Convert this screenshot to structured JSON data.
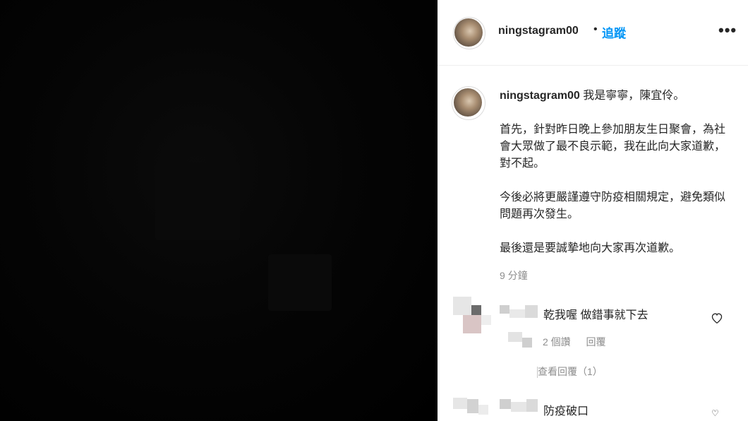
{
  "post": {
    "username": "ningstagram00",
    "separator": "•",
    "follow_label": "追蹤",
    "more_icon": "more-horizontal-icon",
    "more_label": "•••"
  },
  "caption": {
    "username": "ningstagram00",
    "first_line": "我是寧寧，陳宜伶。",
    "paragraphs": [
      "首先，針對昨日晚上參加朋友生日聚會，為社會大眾做了最不良示範，我在此向大家道歉，對不起。",
      "今後必將更嚴謹遵守防疫相關規定，避免類似問題再次發生。",
      "最後還是要誠摯地向大家再次道歉。"
    ],
    "time": "9 分鐘"
  },
  "comments": [
    {
      "text": "乾我喔 做錯事就下去",
      "likes": "2 個讚",
      "reply_label": "回覆",
      "view_replies": "查看回覆（1）",
      "heart_icon": "heart-outline-icon"
    },
    {
      "text": "防疫破口"
    }
  ]
}
